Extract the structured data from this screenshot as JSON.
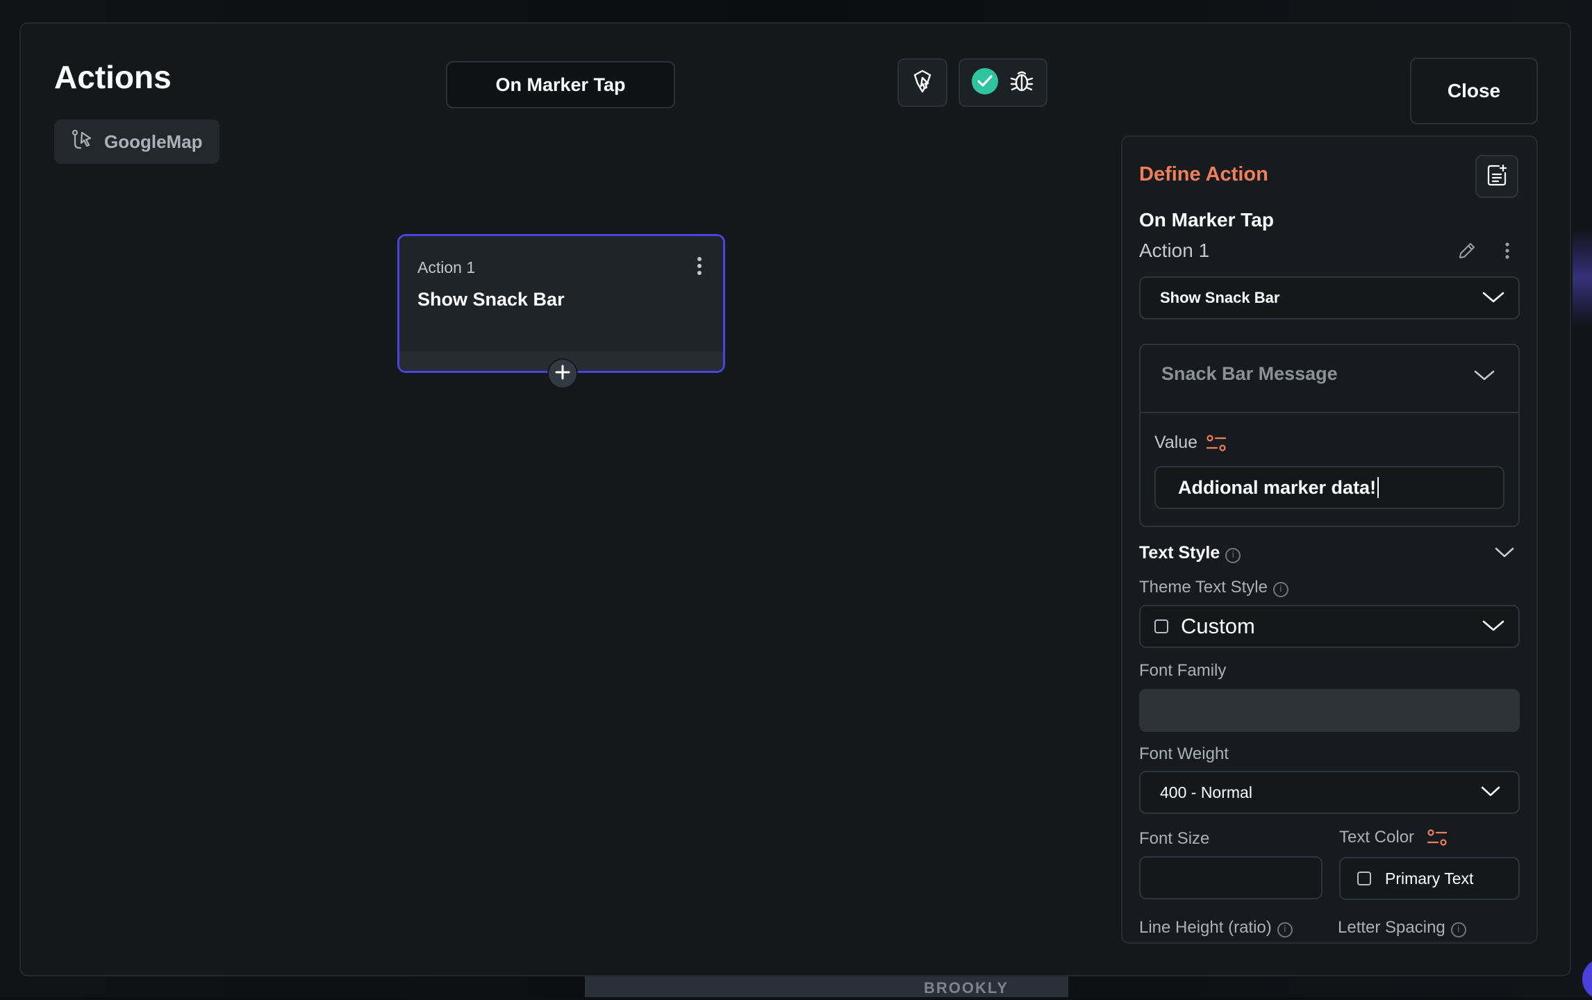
{
  "background": {
    "map_label": "BROOKLY"
  },
  "header": {
    "title": "Actions",
    "widget_chip_label": "GoogleMap",
    "trigger_button_label": "On Marker Tap",
    "close_label": "Close"
  },
  "canvas": {
    "node": {
      "label": "Action 1",
      "title": "Show Snack Bar"
    }
  },
  "panel": {
    "heading": "Define Action",
    "trigger_name": "On Marker Tap",
    "action_name": "Action 1",
    "action_type": "Show Snack Bar",
    "snack_bar_message": {
      "header": "Snack Bar Message",
      "value_label": "Value",
      "value": "Addional marker data!"
    },
    "text_style": {
      "section_label": "Text Style",
      "theme_text_style_label": "Theme Text Style",
      "theme_text_style_value": "Custom",
      "font_family_label": "Font Family",
      "font_family_value": "",
      "font_weight_label": "Font Weight",
      "font_weight_value": "400 - Normal",
      "font_size_label": "Font Size",
      "font_size_value": "",
      "text_color_label": "Text Color",
      "text_color_value": "Primary Text",
      "line_height_label": "Line Height (ratio)",
      "letter_spacing_label": "Letter Spacing"
    }
  },
  "colors": {
    "accent": "#4c44e0",
    "define_action": "#f0805a",
    "success": "#2ec4a0",
    "variable_icon": "#f0805a"
  }
}
